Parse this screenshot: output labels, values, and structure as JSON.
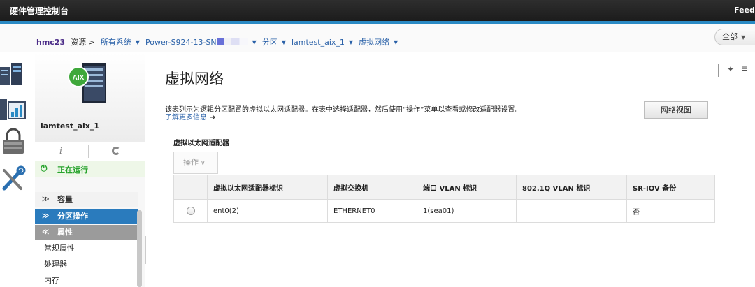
{
  "app": {
    "title": "硬件管理控制台",
    "feedback_label": "Feedback"
  },
  "breadcrumb": {
    "host": "hmc23",
    "resources": "资源 >",
    "all_systems": "所有系统",
    "system": "Power-S924-13-SN",
    "partitions": "分区",
    "partition_name": "lamtest_aix_1",
    "virtual_network": "虚拟网络"
  },
  "scope_button": {
    "label": "全部"
  },
  "rail": {
    "icons": [
      "server-rack-icon",
      "performance-chart-icon",
      "security-lock-icon",
      "tools-icon"
    ]
  },
  "nav": {
    "partition_name": "lamtest_aix_1",
    "badge": "AIX",
    "status": "正在运行",
    "sections": {
      "capacity": "容量",
      "partition_ops": "分区操作",
      "properties": "属性"
    },
    "subitems": [
      "常规属性",
      "处理器",
      "内存"
    ]
  },
  "main": {
    "title": "虚拟网络",
    "description": "该表列示为逻辑分区配置的虚拟以太网适配器。在表中选择适配器，然后使用“操作”菜单以查看或修改适配器设置。",
    "learn_more": "了解更多信息",
    "network_view_button": "网络视图",
    "table_title": "虚拟以太网适配器",
    "actions_button": "操作"
  },
  "table": {
    "columns": [
      "",
      "虚拟以太网适配器标识",
      "虚拟交换机",
      "端口 VLAN 标识",
      "802.1Q VLAN 标识",
      "SR-IOV 备份"
    ],
    "rows": [
      {
        "id": "ent0(2)",
        "vswitch": "ETHERNET0",
        "pvid": "1(sea01)",
        "vlan8021q": "",
        "sriov": "否"
      }
    ]
  },
  "colors": {
    "accent": "#2a8ac4",
    "nav_selected": "#2a7bbd",
    "running": "#27a32c",
    "link": "#2a61a8"
  }
}
